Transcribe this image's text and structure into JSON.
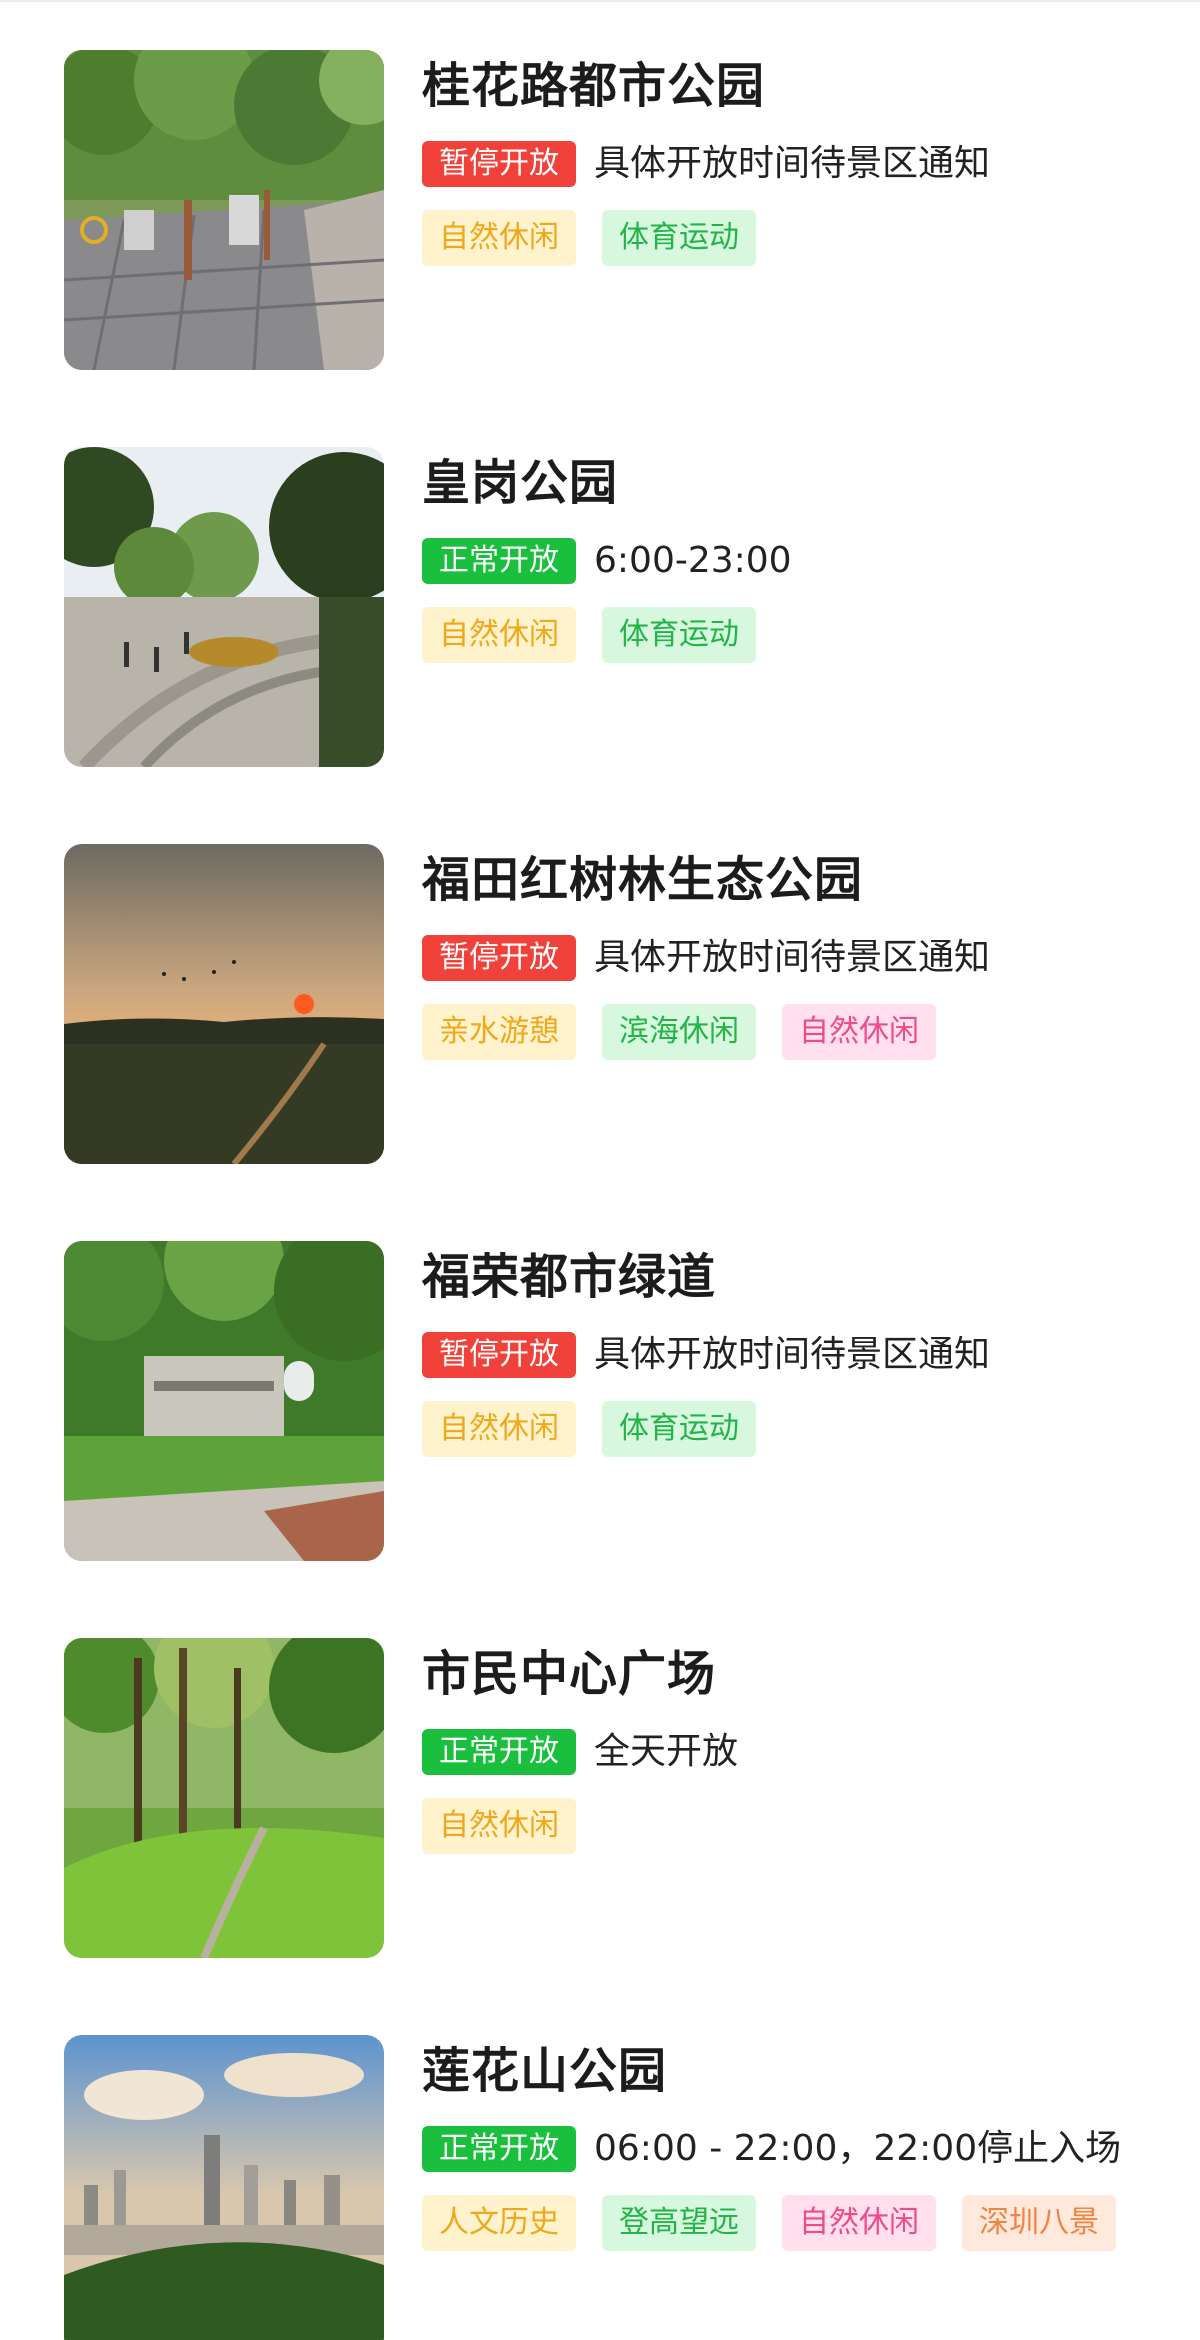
{
  "parks": [
    {
      "name": "桂花路都市公园",
      "status": "暂停开放",
      "status_type": "closed",
      "hours": "具体开放时间待景区通知",
      "photo": "fitness-plaza-photo",
      "tags": [
        {
          "label": "自然休闲",
          "color": "yellow"
        },
        {
          "label": "体育运动",
          "color": "green"
        }
      ]
    },
    {
      "name": "皇岗公园",
      "status": "正常开放",
      "status_type": "open",
      "hours": "6:00-23:00",
      "photo": "park-plaza-photo",
      "tags": [
        {
          "label": "自然休闲",
          "color": "yellow"
        },
        {
          "label": "体育运动",
          "color": "green"
        }
      ]
    },
    {
      "name": "福田红树林生态公园",
      "status": "暂停开放",
      "status_type": "closed",
      "hours": "具体开放时间待景区通知",
      "photo": "mangrove-sunset-photo",
      "tags": [
        {
          "label": "亲水游憩",
          "color": "yellow"
        },
        {
          "label": "滨海休闲",
          "color": "green"
        },
        {
          "label": "自然休闲",
          "color": "pink"
        }
      ]
    },
    {
      "name": "福荣都市绿道",
      "status": "暂停开放",
      "status_type": "closed",
      "hours": "具体开放时间待景区通知",
      "photo": "greenway-sign-photo",
      "tags": [
        {
          "label": "自然休闲",
          "color": "yellow"
        },
        {
          "label": "体育运动",
          "color": "green"
        }
      ]
    },
    {
      "name": "市民中心广场",
      "status": "正常开放",
      "status_type": "open",
      "hours": "全天开放",
      "photo": "forest-lawn-photo",
      "tags": [
        {
          "label": "自然休闲",
          "color": "yellow"
        }
      ]
    },
    {
      "name": "莲花山公园",
      "status": "正常开放",
      "status_type": "open",
      "hours": "06:00 - 22:00，22:00停止入场",
      "photo": "city-skyline-photo",
      "tags": [
        {
          "label": "人文历史",
          "color": "yellow"
        },
        {
          "label": "登高望远",
          "color": "green"
        },
        {
          "label": "自然休闲",
          "color": "pink"
        },
        {
          "label": "深圳八景",
          "color": "peach"
        }
      ]
    }
  ]
}
